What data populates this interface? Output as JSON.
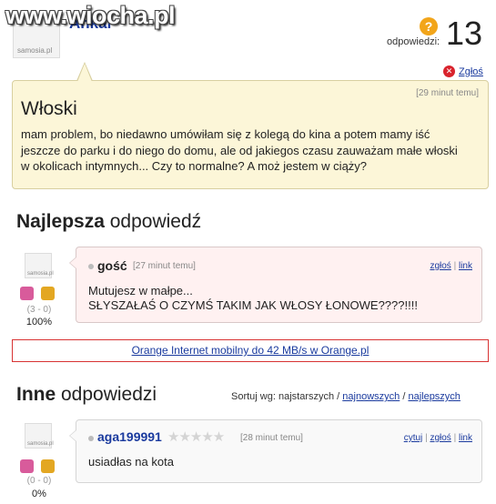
{
  "header": {
    "watermark": "www.wiocha.pl",
    "avatar_caption": "samosia.pl",
    "username": "Ankar",
    "answers_label": "odpowiedzi:",
    "answers_count": "13",
    "report_label": "Zgłoś"
  },
  "question": {
    "time": "[29 minut temu]",
    "title": "Włoski",
    "body": "mam problem, bo niedawno umówiłam się z kolegą do kina a potem mamy iść jeszcze do parku i do niego do domu, ale od jakiegos czasu zauważam małe włoski w okolicach intymnych... Czy to normalne? A moż jestem w ciąży?"
  },
  "best": {
    "heading_bold": "Najlepsza",
    "heading_rest": " odpowiedź",
    "avatar_caption": "samosia.pl",
    "author": "gość",
    "time": "[27 minut temu]",
    "report_link": "zgłoś",
    "separator": "|",
    "link_label": "link",
    "text_line1": "Mutujesz w małpe...",
    "text_line2": "SŁYSZAŁAŚ O CZYMŚ TAKIM JAK WŁOSY ŁONOWE????!!!!",
    "votes": "(3 - 0)",
    "percent": "100%"
  },
  "ad": {
    "text": "Orange Internet mobilny do 42 MB/s w Orange.pl"
  },
  "others": {
    "heading_bold": "Inne",
    "heading_rest": " odpowiedzi",
    "sort_label": "Sortuj wg: najstarszych /",
    "sort_newest": "najnowszych",
    "sort_sep": "/",
    "sort_best": "najlepszych"
  },
  "answer2": {
    "avatar_caption": "samosia.pl",
    "author": "aga199991",
    "stars": "★★★★★",
    "time": "[28 minut temu]",
    "quote_link": "cytuj",
    "separator": "|",
    "report_link": "zgłoś",
    "link_label": "link",
    "text": "usiadłas na kota",
    "votes": "(0 - 0)",
    "percent": "0%"
  },
  "colors": {
    "link": "#1a3a9e",
    "question_bg": "#fcf6d8",
    "best_answer_bg": "#fff1f1",
    "ad_border": "#d83333"
  }
}
